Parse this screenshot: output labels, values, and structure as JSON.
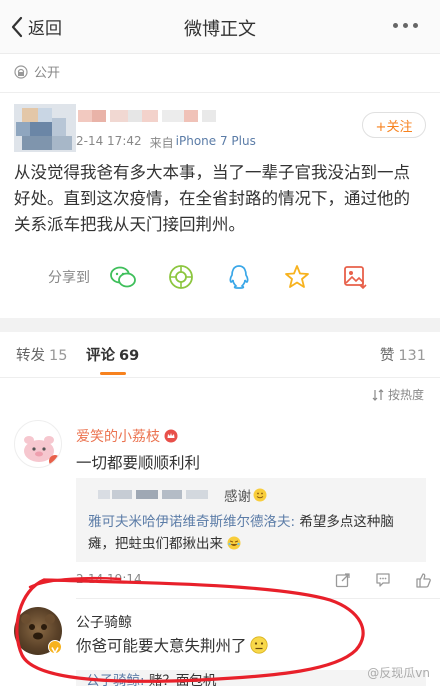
{
  "header": {
    "back_label": "返回",
    "title": "微博正文"
  },
  "visibility": {
    "label": "公开"
  },
  "post": {
    "time": "2-14 17:42",
    "source_prefix": "来自",
    "device": "iPhone 7 Plus",
    "follow_label": "+关注",
    "text": "从没觉得我爸有多大本事，当了一辈子官我没沾到一点好处。直到这次疫情，在全省封路的情况下，通过他的关系派车把我从天门接回荆州。"
  },
  "share": {
    "label": "分享到"
  },
  "tabs": {
    "repost_label": "转发",
    "repost_count": "15",
    "comment_label": "评论",
    "comment_count": "69",
    "like_label": "赞",
    "like_count": "131"
  },
  "sort": {
    "label": "按热度"
  },
  "comments": [
    {
      "user": "爱笑的小荔枝",
      "text": "一切都要顺顺利利",
      "reply_thanks": "感谢",
      "reply2_user": "雅可夫米哈伊诺维奇斯维尔德洛夫:",
      "reply2_text": " 希望多点这种脑瘫，把蛀虫们都揪出来",
      "time": "2-14 19:14"
    },
    {
      "user": "公子骑鲸",
      "text": "你爸可能要大意失荆州了",
      "reply_user": "公子骑鲸:",
      "reply_text": " 赌？面包机"
    }
  ],
  "watermark": "@反现瓜vn",
  "colors": {
    "accent": "#f7821e",
    "link": "#5b7ca7",
    "red_circle": "#e8202a"
  }
}
